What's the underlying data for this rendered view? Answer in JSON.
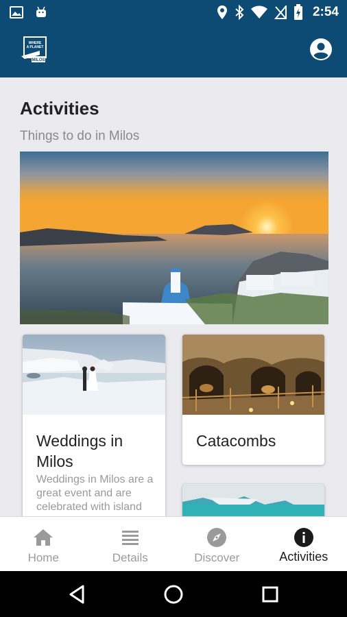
{
  "status_bar": {
    "time": "2:54",
    "icons": [
      "image-icon",
      "android-icon",
      "location-icon",
      "bluetooth-icon",
      "wifi-icon",
      "no-sim-icon",
      "battery-charging-icon"
    ]
  },
  "app_bar": {
    "logo_lines": [
      "WHERE",
      "A PLANET",
      "MILOS"
    ],
    "icons": [
      "app-logo-icon",
      "account-circle-icon"
    ]
  },
  "page": {
    "title": "Activities",
    "subtitle": "Things to do in Milos"
  },
  "cards": [
    {
      "title": "Weddings in Milos",
      "description": "Weddings in Milos are a great event and are celebrated with island"
    },
    {
      "title": "Catacombs"
    }
  ],
  "bottom_nav": {
    "items": [
      {
        "label": "Home",
        "icon": "home-icon",
        "active": false
      },
      {
        "label": "Details",
        "icon": "list-icon",
        "active": false
      },
      {
        "label": "Discover",
        "icon": "compass-icon",
        "active": false
      },
      {
        "label": "Activities",
        "icon": "info-icon",
        "active": true
      }
    ]
  },
  "system_nav": {
    "icons": [
      "back-icon",
      "home-circle-icon",
      "recents-icon"
    ]
  },
  "colors": {
    "primary": "#0d4a74",
    "background": "#ebebef",
    "nav_inactive": "#9a9a9a",
    "nav_active": "#1a1a1a"
  }
}
